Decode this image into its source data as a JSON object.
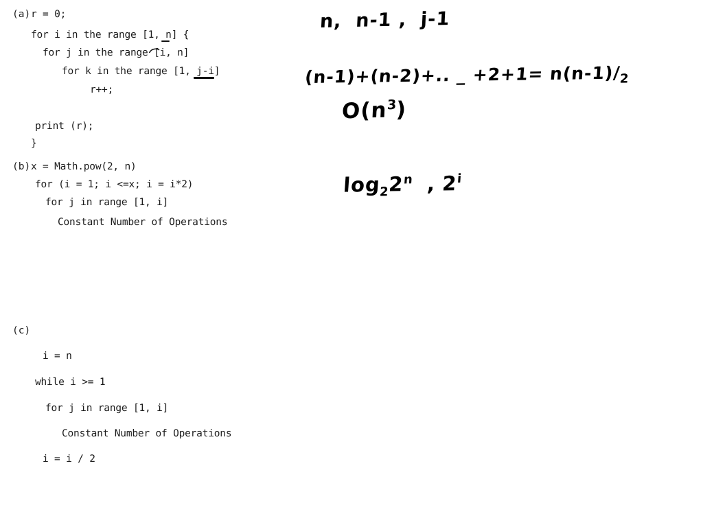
{
  "document": {
    "background_color": "#ffffff",
    "ink_color": "#1c1c1c",
    "pen_color": "#000000"
  },
  "parts": [
    {
      "label": "(a)",
      "lines": [
        "r = 0;",
        "for i in the range [1, n] {",
        "for j in the range [i, n]",
        "for k in the range [1, j-i]",
        "r++;",
        "print (r);",
        "}"
      ]
    },
    {
      "label": "(b)",
      "lines": [
        "x = Math.pow(2, n)",
        "for (i = 1; i <=x; i = i*2)",
        "for j in range [1, i]",
        "Constant Number of Operations"
      ]
    },
    {
      "label": "(c)",
      "lines": [
        "i = n",
        "while i >= 1",
        "for j in range [1, i]",
        "Constant Number of Operations",
        "i = i / 2"
      ]
    }
  ],
  "annotations": {
    "line1": "n,  n-1 ,  j-1",
    "line1_tokens": [
      "n,",
      "n-1 ,",
      "j-1"
    ],
    "line2_prefix": "(n-1)+(n-2)+.. _ +2+1= n(n-1)/",
    "line2_denominator": "2",
    "line2_full": "(n-1)+(n-2)+.. _ +2+1= n(n-1)/2",
    "line3_prefix": "O(n",
    "line3_exponent": "3",
    "line3_suffix": ")",
    "line3_full": "O(n3)",
    "line4_log": "log",
    "line4_log_base": "2",
    "line4_two": "2",
    "line4_two_exp": "n",
    "line4_comma": ",",
    "line4_second_two": "2",
    "line4_second_exp": "i",
    "line4_full": "log2 2^n , 2^i"
  }
}
